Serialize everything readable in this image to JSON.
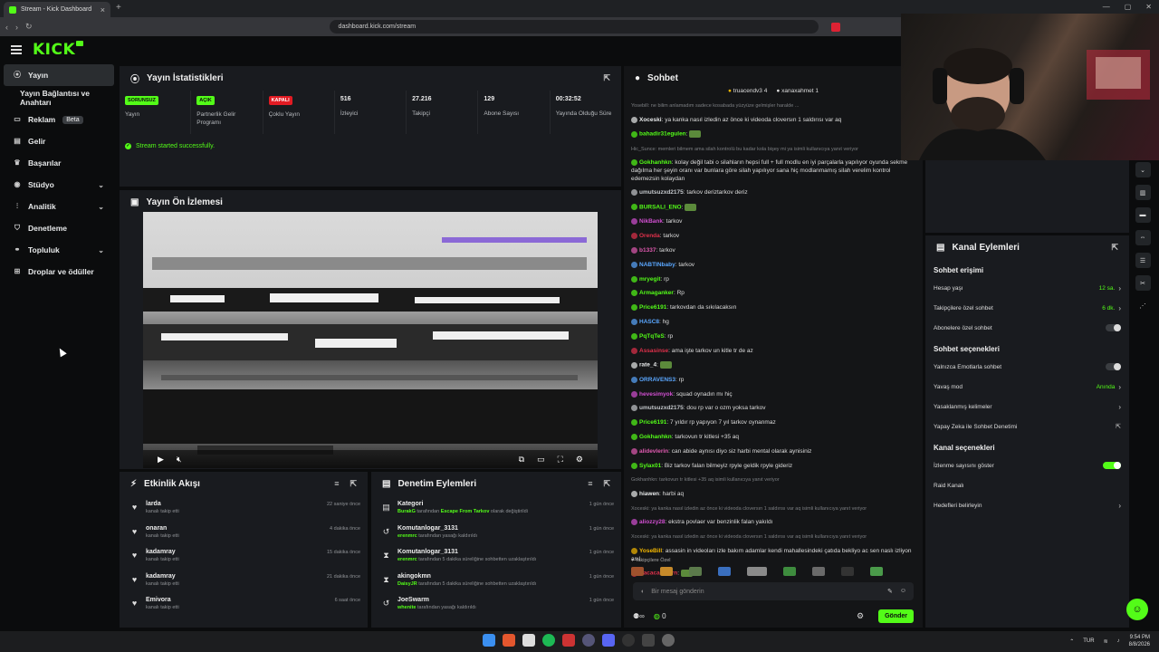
{
  "browser": {
    "tab_title": "Stream - Kick Dashboard",
    "url": "dashboard.kick.com/stream"
  },
  "brand": {
    "logo": "KICK",
    "accent": "#53fc18"
  },
  "sidebar": {
    "items": [
      {
        "label": "Yayın",
        "icon": "broadcast-icon",
        "active": true
      },
      {
        "label": "Yayın Bağlantısı ve Anahtarı",
        "sub": true
      },
      {
        "label": "Reklam",
        "icon": "ad-icon",
        "badge": "Beta"
      },
      {
        "label": "Gelir",
        "icon": "money-icon"
      },
      {
        "label": "Başarılar",
        "icon": "trophy-icon"
      },
      {
        "label": "Stüdyo",
        "icon": "studio-icon",
        "chevron": true
      },
      {
        "label": "Analitik",
        "icon": "chart-icon",
        "chevron": true
      },
      {
        "label": "Denetleme",
        "icon": "shield-icon"
      },
      {
        "label": "Topluluk",
        "icon": "community-icon",
        "chevron": true
      },
      {
        "label": "Droplar ve ödüller",
        "icon": "gift-icon"
      }
    ]
  },
  "stats": {
    "title": "Yayın İstatistikleri",
    "items": [
      {
        "pill": "SORUNSUZ",
        "pill_color": "green",
        "label": "Yayın"
      },
      {
        "pill": "AÇIK",
        "pill_color": "green",
        "label": "Partnerlik Gelir Programı"
      },
      {
        "pill": "KAPALI",
        "pill_color": "red",
        "label": "Çoklu Yayın"
      },
      {
        "value": "516",
        "label": "İzleyici"
      },
      {
        "value": "27.216",
        "label": "Takipçi"
      },
      {
        "value": "129",
        "label": "Abone Sayısı"
      },
      {
        "value": "00:32:52",
        "label": "Yayında Olduğu Süre"
      }
    ],
    "success_message": "Stream started successfully."
  },
  "preview": {
    "title": "Yayın Ön İzlemesi"
  },
  "activity": {
    "title": "Etkinlik Akışı",
    "items": [
      {
        "name": "larda",
        "sub": "kanalı takip etti",
        "time": "22 saniye önce"
      },
      {
        "name": "onaran",
        "sub": "kanalı takip etti",
        "time": "4 dakika önce"
      },
      {
        "name": "kadamray",
        "sub": "kanalı takip etti",
        "time": "15 dakika önce"
      },
      {
        "name": "kadamray",
        "sub": "kanalı takip etti",
        "time": "21 dakika önce"
      },
      {
        "name": "Emivora",
        "sub": "kanalı takip etti",
        "time": "6 saat önce"
      }
    ]
  },
  "moderation": {
    "title": "Denetim Eylemleri",
    "items": [
      {
        "icon": "category-icon",
        "name": "Kategori",
        "actor": "BurakG",
        "mid": " tarafından ",
        "hl": "Escape From Tarkov",
        "rest": " olarak değiştirildi",
        "time": "1 gün önce"
      },
      {
        "icon": "unban-icon",
        "name": "Komutanlogar_3131",
        "actor": "erenmrc",
        "mid": " tarafından yasağı kaldırıldı",
        "hl": "",
        "rest": "",
        "time": "1 gün önce"
      },
      {
        "icon": "timeout-icon",
        "name": "Komutanlogar_3131",
        "actor": "erenmrc",
        "mid": " tarafından 5 dakika süreliğine sohbetten uzaklaştırıldı",
        "hl": "",
        "rest": "",
        "time": "1 gün önce"
      },
      {
        "icon": "timeout-icon",
        "name": "akingokmn",
        "actor": "DaisyJR",
        "mid": " tarafından 5 dakika süreliğine sohbetten uzaklaştırıldı",
        "hl": "",
        "rest": "",
        "time": "1 gün önce"
      },
      {
        "icon": "unban-icon",
        "name": "JoeSwarm",
        "actor": "whenite",
        "mid": " tarafından yasağı kaldırıldı",
        "hl": "",
        "rest": "",
        "time": "1 gün önce"
      }
    ]
  },
  "chat": {
    "title": "Sohbet",
    "top_gifters": [
      {
        "name": "truacendv3",
        "count": "4"
      },
      {
        "name": "xanaxahmet",
        "count": "1"
      }
    ],
    "messages": [
      {
        "sys": "Yosebill: ne bilim anlamadım sadece kosabada yüzyüze gelmişler haralde ...",
        "user": "",
        "color": "",
        "text": ""
      },
      {
        "user": "Xoceski",
        "color": "#e7e9ea",
        "text": "ya kanka nasıl izledin az önce ki videoda cloversın 1 saldırısı var aq"
      },
      {
        "user": "bahadir31egulen",
        "color": "#53fc18",
        "text": ""
      },
      {
        "sys": "Hic_Sunce: memleri bilmem ama silah kontrolü bu kadar kola bişey mi ya isimli kullanıcıya yanıt veriyor",
        "user": "",
        "color": "",
        "text": ""
      },
      {
        "user": "Gokhanhkn",
        "color": "#53fc18",
        "text": "kolay değil tabi o silahların hepsi full + full modlu en iyi parçalarla yapılıyor oyunda sekme dağılma her şeyin oranı var bunlara göre silah yapılıyor sana hiç modlanmamış silah verelim kontrol edemezsin kolaydan"
      },
      {
        "user": "umutsuzxd2175",
        "color": "#c4c8cc",
        "text": "tarkov deriztarkov deriz"
      },
      {
        "user": "BURSALI_ENO",
        "color": "#53fc18",
        "text": ""
      },
      {
        "user": "NikBank",
        "color": "#d14fd1",
        "text": "tarkov"
      },
      {
        "user": "Orenda",
        "color": "#e0314b",
        "text": "tarkov"
      },
      {
        "user": "b1337",
        "color": "#e05ab0",
        "text": "tarkov"
      },
      {
        "user": "NABTINbaby",
        "color": "#5aa7ff",
        "text": "tarkov"
      },
      {
        "user": "mryegit",
        "color": "#53fc18",
        "text": "rp"
      },
      {
        "user": "Armaganker",
        "color": "#53fc18",
        "text": "Rp"
      },
      {
        "user": "Price6191",
        "color": "#53fc18",
        "text": "tarkovdan da sıkılacaksın"
      },
      {
        "user": "HASC8",
        "color": "#5aa7ff",
        "text": "hg"
      },
      {
        "user": "PqTqTeS",
        "color": "#53fc18",
        "text": "rp"
      },
      {
        "user": "Assasinse",
        "color": "#e0314b",
        "text": "ama işte tarkov un kitle tr de az"
      },
      {
        "user": "rate_4",
        "color": "#e7e9ea",
        "text": ""
      },
      {
        "user": "ORRAVENS3",
        "color": "#5aa7ff",
        "text": "rp"
      },
      {
        "user": "hevesimyok",
        "color": "#d14fd1",
        "text": "squad oynadın mı hiç"
      },
      {
        "user": "umutsuzxd2175",
        "color": "#c4c8cc",
        "text": "dou rp var o ozm yoksa tarkov"
      },
      {
        "user": "Price6191",
        "color": "#53fc18",
        "text": "7 yıldır rp yapıyon 7 yıl tarkov oynanmaz"
      },
      {
        "user": "Gokhanhkn",
        "color": "#53fc18",
        "text": "tarkovun tr kitlesi +35 aq"
      },
      {
        "user": "alidevlerin",
        "color": "#e05ab0",
        "text": "can abide aynısı diyo siz harbi mental olarak aynisiniz"
      },
      {
        "user": "Sylax01",
        "color": "#53fc18",
        "text": "Biz tarkov falan bilmeyiz rpyle geldik rpyle gideriz"
      },
      {
        "sys": "Gokhanhkn: tarkovun tr kitlesi +35 aq isimli kullanıcıya yanıt veriyor",
        "user": "",
        "color": "",
        "text": ""
      },
      {
        "user": "hiawen",
        "color": "#e7e9ea",
        "text": "harbi aq"
      },
      {
        "sys": "Xoceski: ya kanka nasıl izledin az önce ki videoda cloversın 1 saldırısı var aq isimli kullanıcıya yanıt veriyor",
        "user": "",
        "color": "",
        "text": ""
      },
      {
        "user": "aliozzy28",
        "color": "#d14fd1",
        "text": "ekstra povlaer var benzinlik falan yakıldı"
      },
      {
        "sys": "Xoceski: ya kanka nasıl izledin az önce ki videoda cloversın 1 saldırısı var aq isimli kullanıcıya yanıt veriyor",
        "user": "",
        "color": "",
        "text": ""
      },
      {
        "user": "YoseBill",
        "color": "#f5b800",
        "text": "assasin in videoları izle bakım adamlar kendi mahallesindeki çatıda bekliyo ac sen naslı izliyon asıl"
      },
      {
        "user": "Kacacaoalarn",
        "color": "#e0314b",
        "text": ""
      }
    ],
    "pinned_label": "Takipçilere Özel",
    "input_placeholder": "Bir mesaj gönderin",
    "counter": "0",
    "send_label": "Gönder"
  },
  "channel_actions": {
    "title": "Kanal Eylemleri",
    "sections": [
      {
        "title": "Sohbet erişimi",
        "rows": [
          {
            "label": "Hesap yaşı",
            "value": "12 sa.",
            "type": "chevron"
          },
          {
            "label": "Takipçilere özel sohbet",
            "value": "6 dk.",
            "type": "chevron"
          },
          {
            "label": "Abonelere özel sohbet",
            "value": "",
            "type": "toggle-off"
          }
        ]
      },
      {
        "title": "Sohbet seçenekleri",
        "rows": [
          {
            "label": "Yalnızca Emotlarla sohbet",
            "value": "",
            "type": "toggle-off"
          },
          {
            "label": "Yavaş mod",
            "value": "Anında",
            "type": "chevron"
          },
          {
            "label": "Yasaklanmış kelimeler",
            "value": "",
            "type": "chevron"
          },
          {
            "label": "Yapay Zeka ile Sohbet Denetimi",
            "value": "",
            "type": "external"
          }
        ]
      },
      {
        "title": "Kanal seçenekleri",
        "rows": [
          {
            "label": "İzlenme sayısını göster",
            "value": "",
            "type": "toggle-on"
          },
          {
            "label": "Raid Kanalı",
            "value": "",
            "type": "none"
          },
          {
            "label": "Hedefleri belirleyin",
            "value": "",
            "type": "chevron"
          }
        ]
      }
    ]
  },
  "taskbar": {
    "lang": "TUR",
    "time": "9:54 PM",
    "date": "8/8/2026"
  }
}
